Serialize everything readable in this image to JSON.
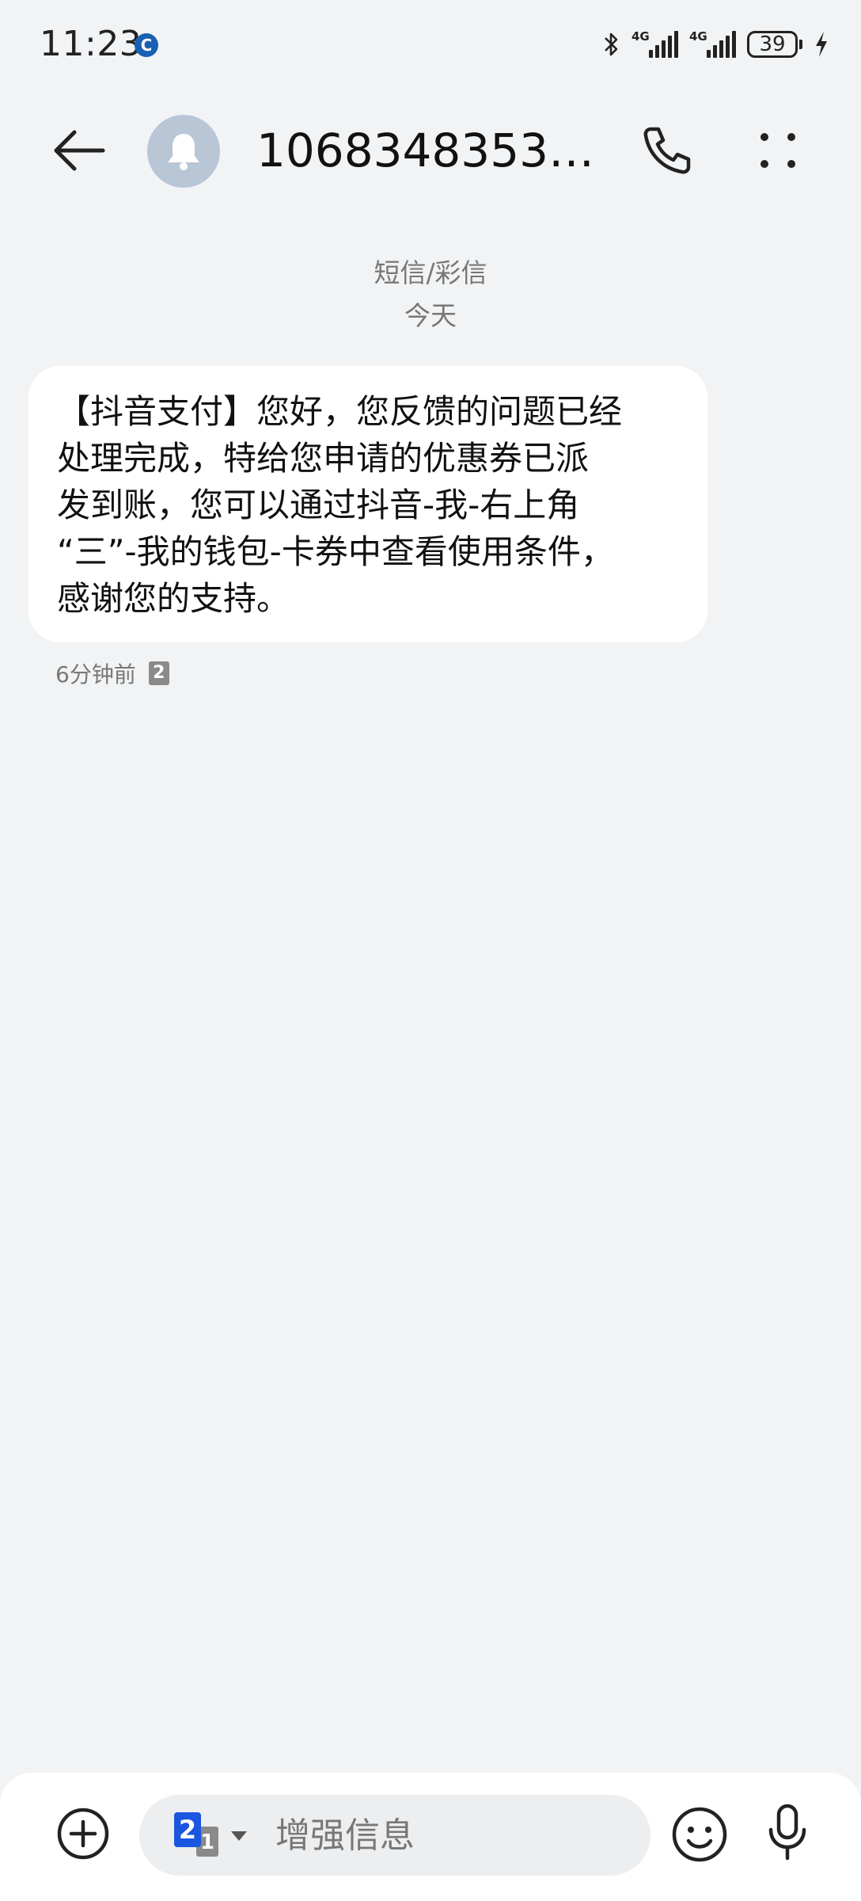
{
  "status_bar": {
    "time": "11:23",
    "notification_icon": "app-notification-icon",
    "signal_1_label": "4G",
    "signal_2_label": "4G",
    "battery": "39",
    "icons": [
      "bluetooth-icon",
      "signal-icon",
      "signal-icon",
      "battery-icon",
      "charging-icon"
    ]
  },
  "header": {
    "contact": "10683483530...",
    "avatar_icon": "bell-icon",
    "back_icon": "back-arrow-icon",
    "call_icon": "phone-icon",
    "more_icon": "more-dots-icon"
  },
  "conversation": {
    "message_type": "短信/彩信",
    "date_label": "今天",
    "messages": [
      {
        "lines": [
          "【抖音支付】您好，您反馈的问题已经",
          "处理完成，特给您申请的优惠券已派",
          "发到账，您可以通过抖音-我-右上角",
          "“三”-我的钱包-卡券中查看使用条件，",
          "感谢您的支持。"
        ],
        "time": "6分钟前",
        "sim": "2"
      }
    ]
  },
  "composer": {
    "placeholder": "增强信息",
    "sim_selected": "2",
    "sim_other": "1",
    "icons": [
      "add-icon",
      "sim-select-icon",
      "emoji-icon",
      "microphone-icon"
    ]
  },
  "colors": {
    "background": "#f1f3f5",
    "bubble": "#ffffff",
    "avatar": "#b8c6d6",
    "sim_blue": "#1a56e0",
    "secondary_text": "#777777"
  }
}
